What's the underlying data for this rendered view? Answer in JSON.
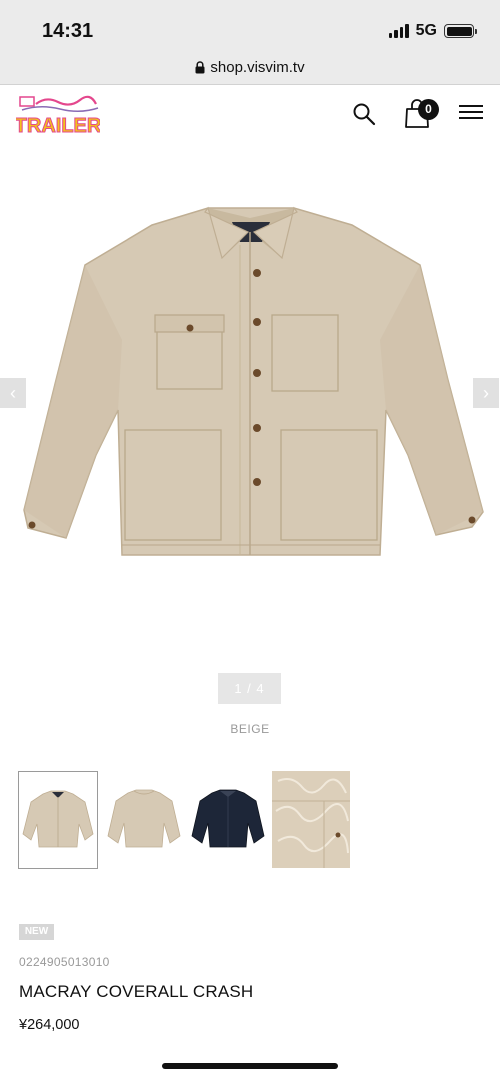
{
  "status_bar": {
    "time": "14:31",
    "network": "5G",
    "icons": [
      "signal-icon",
      "battery-icon"
    ]
  },
  "browser": {
    "url": "shop.visvim.tv",
    "icons": [
      "lock-icon"
    ]
  },
  "header": {
    "logo_text": "TRAILER",
    "cart_count": "0",
    "icons": [
      "search-icon",
      "shopping-bag-icon",
      "hamburger-menu-icon"
    ]
  },
  "gallery": {
    "counter": "1 / 4",
    "color": "BEIGE",
    "prev_arrow": "‹",
    "next_arrow": "›",
    "thumbnail_count": 4,
    "active_thumbnail": 1
  },
  "product": {
    "badge": "NEW",
    "sku": "0224905013010",
    "name": "MACRAY COVERALL CRASH",
    "price": "¥264,000"
  },
  "colors": {
    "jacket_beige": "#d6c9b4",
    "jacket_navy": "#1d2638",
    "status_bg": "#ebebeb",
    "logo_yellow": "#f2c21b",
    "logo_pink": "#e4478d"
  }
}
